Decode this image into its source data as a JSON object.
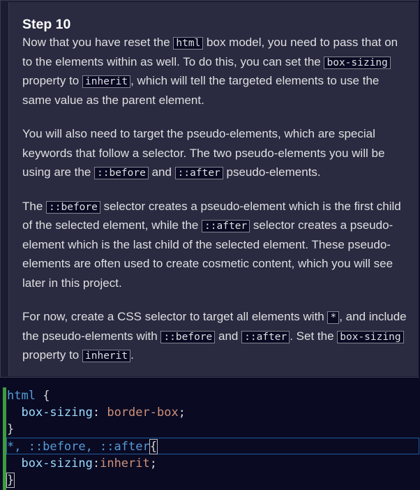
{
  "step": {
    "title": "Step 10",
    "p1": {
      "t1": "Now that you have reset the ",
      "c1": "html",
      "t2": " box model, you need to pass that on to the elements within as well. To do this, you can set the ",
      "c2": "box-sizing",
      "t3": " property to ",
      "c3": "inherit",
      "t4": ", which will tell the targeted elements to use the same value as the parent element."
    },
    "p2": {
      "t1": "You will also need to target the pseudo-elements, which are special keywords that follow a selector. The two pseudo-elements you will be using are the ",
      "c1": "::before",
      "t2": " and ",
      "c2": "::after",
      "t3": " pseudo-elements."
    },
    "p3": {
      "t1": "The ",
      "c1": "::before",
      "t2": " selector creates a pseudo-element which is the first child of the selected element, while the ",
      "c2": "::after",
      "t3": " selector creates a pseudo-element which is the last child of the selected element. These pseudo-elements are often used to create cosmetic content, which you will see later in this project."
    },
    "p4": {
      "t1": "For now, create a CSS selector to target all elements with ",
      "c1": "*",
      "t2": ", and include the pseudo-elements with ",
      "c2": "::before",
      "t3": " and ",
      "c3": "::after",
      "t4": ". Set the ",
      "c4": "box-sizing",
      "t5": " property to ",
      "c5": "inherit",
      "t6": "."
    }
  },
  "editor": {
    "line1": {
      "selector": "html",
      "brace": " {"
    },
    "line2": {
      "indent": "  ",
      "prop": "box-sizing",
      "colon": ": ",
      "value": "border-box",
      "semi": ";"
    },
    "line3": {
      "brace": "}"
    },
    "line4": {
      "selector": "*, ::before, ::after",
      "brace": "{"
    },
    "line5": {
      "indent": "  ",
      "prop": "box-sizing",
      "colon": ":",
      "value": "inherit",
      "semi": ";"
    },
    "line6": {
      "brace": "}"
    }
  }
}
